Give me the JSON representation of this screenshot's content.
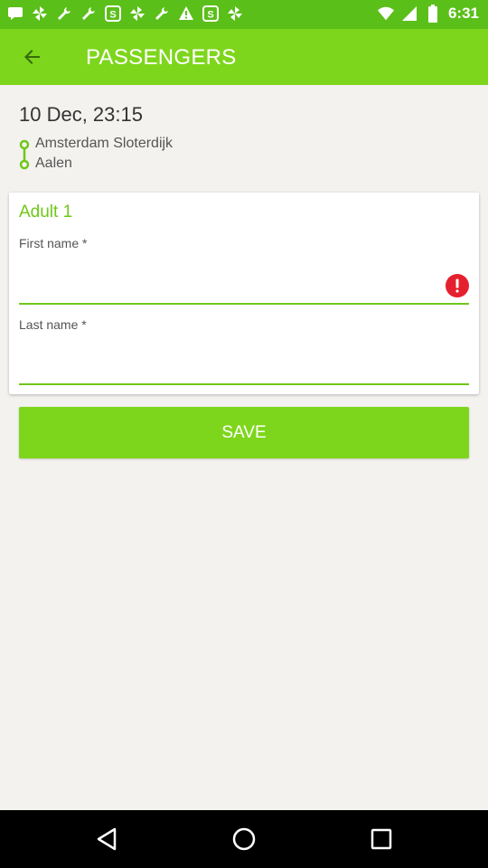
{
  "status_bar": {
    "time": "6:31",
    "icons": [
      "message-icon",
      "pinwheel-icon",
      "wrench-icon",
      "wrench-icon",
      "s-app-icon",
      "pinwheel-icon",
      "wrench-icon",
      "warning-icon",
      "s-app-icon",
      "pinwheel-icon",
      "wifi-icon",
      "signal-icon",
      "battery-icon"
    ]
  },
  "app_bar": {
    "title": "PASSENGERS",
    "back_icon": "arrow-back-icon"
  },
  "trip": {
    "datetime": "10 Dec, 23:15",
    "from": "Amsterdam Sloterdijk",
    "to": "Aalen"
  },
  "passenger_form": {
    "heading": "Adult 1",
    "first_name": {
      "label": "First name *",
      "value": "",
      "placeholder": "",
      "error": true
    },
    "last_name": {
      "label": "Last name *",
      "value": "",
      "placeholder": ""
    }
  },
  "save_label": "SAVE",
  "nav_bar": {
    "back": "nav-back-icon",
    "home": "nav-home-icon",
    "recents": "nav-recents-icon"
  },
  "colors": {
    "status_bar": "#5bbf1a",
    "app_bar": "#7ed61c",
    "accent": "#6fc719",
    "error": "#e5202e",
    "background": "#f3f2ef"
  }
}
